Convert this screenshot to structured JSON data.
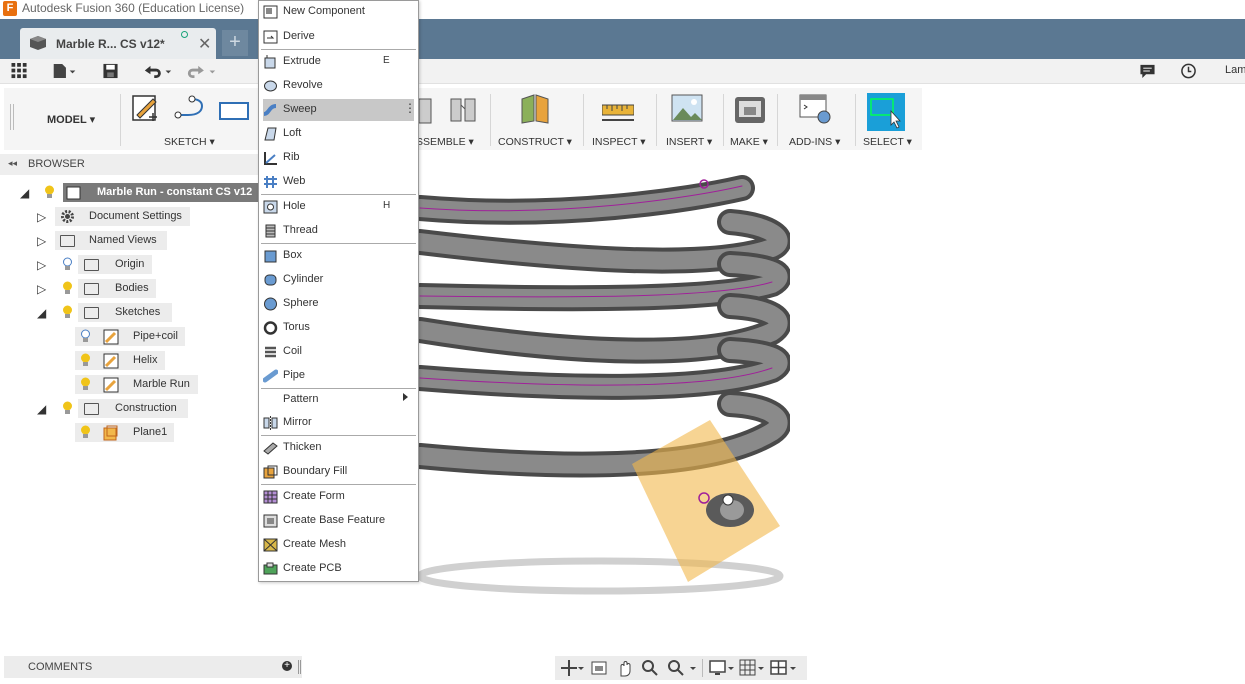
{
  "titlebar": {
    "logo": "F",
    "title": "Autodesk Fusion 360 (Education License)"
  },
  "tab": {
    "label": "Marble R... CS v12*",
    "close": "✕",
    "new": "+"
  },
  "qbar": {
    "user": "Lam"
  },
  "ribbon": {
    "workspace": "MODEL ▾",
    "groups": {
      "sketch": "SKETCH ▾",
      "assemble": "SSEMBLE ▾",
      "construct": "CONSTRUCT ▾",
      "inspect": "INSPECT ▾",
      "insert": "INSERT ▾",
      "make": "MAKE ▾",
      "addins": "ADD-INS ▾",
      "select": "SELECT ▾"
    }
  },
  "browser": {
    "title": "BROWSER",
    "collapse": "◂◂",
    "root": "Marble Run - constant CS v12",
    "items": {
      "docsettings": "Document Settings",
      "namedviews": "Named Views",
      "origin": "Origin",
      "bodies": "Bodies",
      "sketches": "Sketches",
      "pipecoil": "Pipe+coil",
      "helix": "Helix",
      "marblerun": "Marble Run",
      "construction": "Construction",
      "plane1": "Plane1"
    }
  },
  "menu": {
    "new_component": "New Component",
    "derive": "Derive",
    "extrude": "Extrude",
    "extrude_key": "E",
    "revolve": "Revolve",
    "sweep": "Sweep",
    "sweep_more": "⋮",
    "loft": "Loft",
    "rib": "Rib",
    "web": "Web",
    "hole": "Hole",
    "hole_key": "H",
    "thread": "Thread",
    "box": "Box",
    "cylinder": "Cylinder",
    "sphere": "Sphere",
    "torus": "Torus",
    "coil": "Coil",
    "pipe": "Pipe",
    "pattern": "Pattern",
    "mirror": "Mirror",
    "thicken": "Thicken",
    "boundary_fill": "Boundary Fill",
    "create_form": "Create Form",
    "create_base_feature": "Create Base Feature",
    "create_mesh": "Create Mesh",
    "create_pcb": "Create PCB"
  },
  "comments": {
    "title": "COMMENTS",
    "plus": "+"
  },
  "colors": {
    "tabbar": "#5b7892",
    "accent": "#e8700f",
    "select": "#1a9fd8",
    "plane": "#f2b84b",
    "path": "#a0209a"
  },
  "icons": [
    "grid-icon",
    "file-icon",
    "save-icon",
    "undo-icon",
    "redo-icon",
    "comment-icon",
    "clock-icon",
    "gear-icon",
    "bulb-icon",
    "folder-icon",
    "sketch-icon",
    "plane-icon",
    "orbit-icon",
    "pan-icon",
    "zoom-icon",
    "display-icon",
    "grid-display-icon",
    "viewport-icon"
  ]
}
